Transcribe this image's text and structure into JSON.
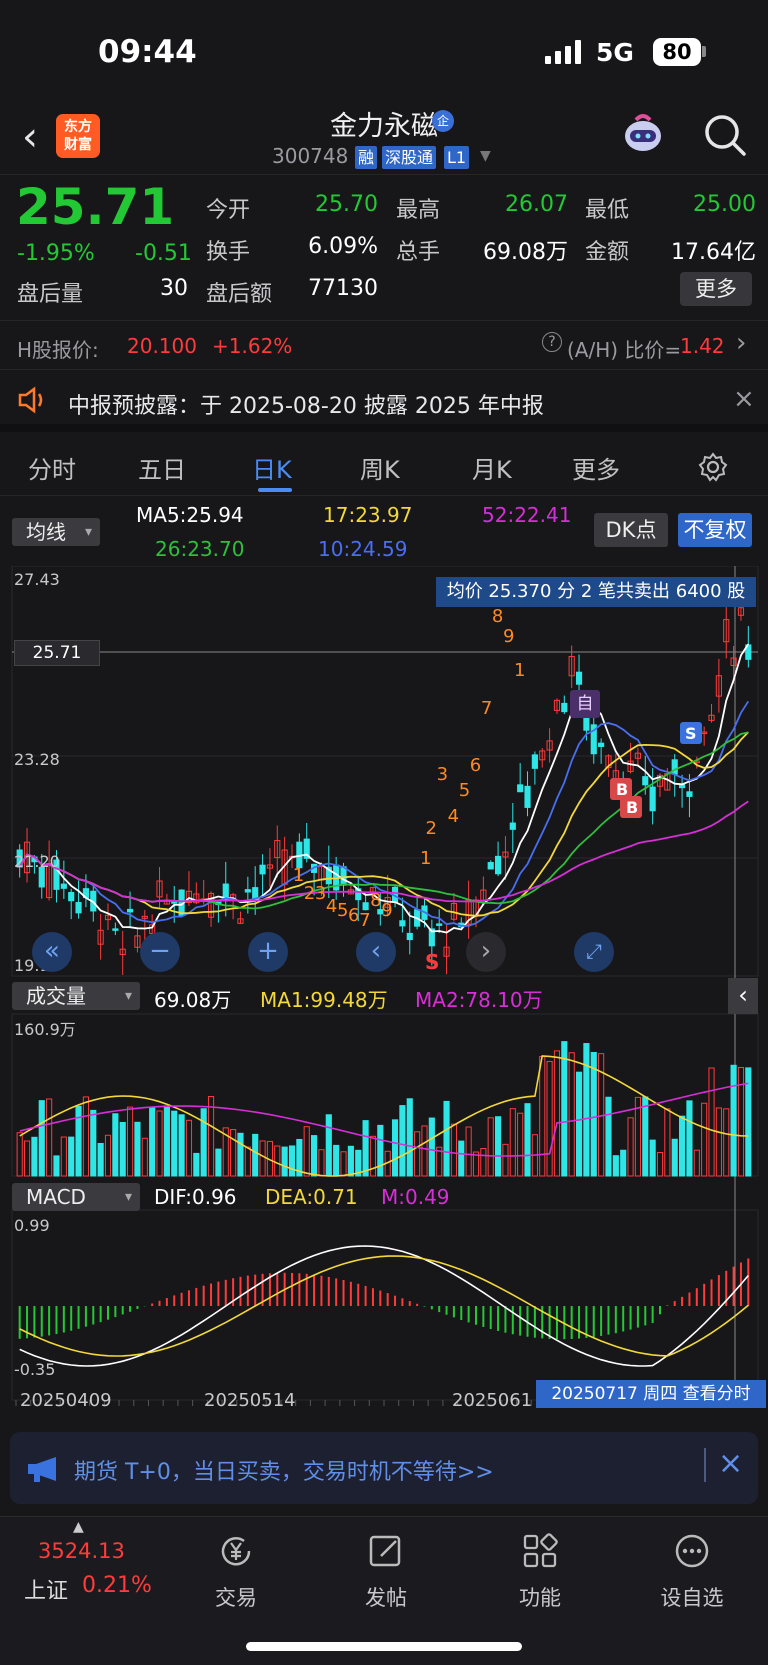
{
  "status": {
    "time": "09:44",
    "network": "5G",
    "battery": "80"
  },
  "header": {
    "logo_line1": "东方",
    "logo_line2": "财富",
    "name": "金力永磁",
    "badge": "企",
    "code": "300748",
    "tags": [
      "融",
      "深股通",
      "L1"
    ]
  },
  "quote": {
    "price": "25.71",
    "pct": "-1.95%",
    "change": "-0.51",
    "labels": {
      "open": "今开",
      "high": "最高",
      "low": "最低",
      "turnover": "换手",
      "volume": "总手",
      "amount": "金额",
      "after_vol": "盘后量",
      "after_amt": "盘后额"
    },
    "values": {
      "open": "25.70",
      "high": "26.07",
      "low": "25.00",
      "turnover": "6.09%",
      "volume": "69.08万",
      "amount": "17.64亿",
      "after_vol": "30",
      "after_amt": "77130"
    },
    "more": "更多"
  },
  "hshare": {
    "label": "H股报价:",
    "price": "20.100",
    "pct": "+1.62%",
    "ratio_label": "(A/H) 比价=",
    "ratio": "1.42"
  },
  "notice": {
    "text": "中报预披露：于 2025-08-20 披露 2025 年中报"
  },
  "tabs": [
    "分时",
    "五日",
    "日K",
    "周K",
    "月K",
    "更多"
  ],
  "active_tab": "日K",
  "ma_row": {
    "selector": "均线",
    "ma5": "MA5:25.94",
    "ma17": "17:23.97",
    "ma52": "52:22.41",
    "ma26": "26:23.70",
    "ma10": "10:24.59",
    "dk": "DK点",
    "fq": "不复权"
  },
  "kline": {
    "levels": {
      "top": "27.43",
      "mid": "23.28",
      "low_mid": "21.20",
      "bottom": "19.12",
      "current": "25.71"
    },
    "tooltip": "均价 25.370 分 2 笔共卖出 6400 股",
    "auto_label": "自",
    "signal_labels": [
      "B",
      "B",
      "S"
    ],
    "s_mark": "S",
    "td_labels": [
      "1",
      "2",
      "3",
      "4",
      "5",
      "6",
      "7",
      "8",
      "9",
      "1",
      "2",
      "3",
      "4",
      "5",
      "6",
      "7",
      "8",
      "9",
      "1",
      "2",
      "3",
      "4",
      "5",
      "6",
      "7",
      "8",
      "9"
    ]
  },
  "volume_row": {
    "selector": "成交量",
    "value": "69.08万",
    "ma1": "MA1:99.48万",
    "ma2": "MA2:78.10万",
    "max": "160.9万"
  },
  "macd_row": {
    "selector": "MACD",
    "dif": "DIF:0.96",
    "dea": "DEA:0.71",
    "m": "M:0.49",
    "max": "0.99",
    "min": "-0.35"
  },
  "dates": {
    "d1": "20250409",
    "d2": "20250514",
    "d3": "2025061",
    "cursor": "20250717 周四 查看分时"
  },
  "banner": {
    "text": "期货 T+0，当日买卖，交易时机不等待>>"
  },
  "bottom_nav": {
    "index_value": "3524.13",
    "index_name": "上证",
    "index_pct": "0.21%",
    "items": [
      "交易",
      "发帖",
      "功能",
      "设自选"
    ]
  },
  "colors": {
    "up": "#ff3b3b",
    "down": "#23c934",
    "accent": "#4a8cf0",
    "bg": "#17171a"
  }
}
